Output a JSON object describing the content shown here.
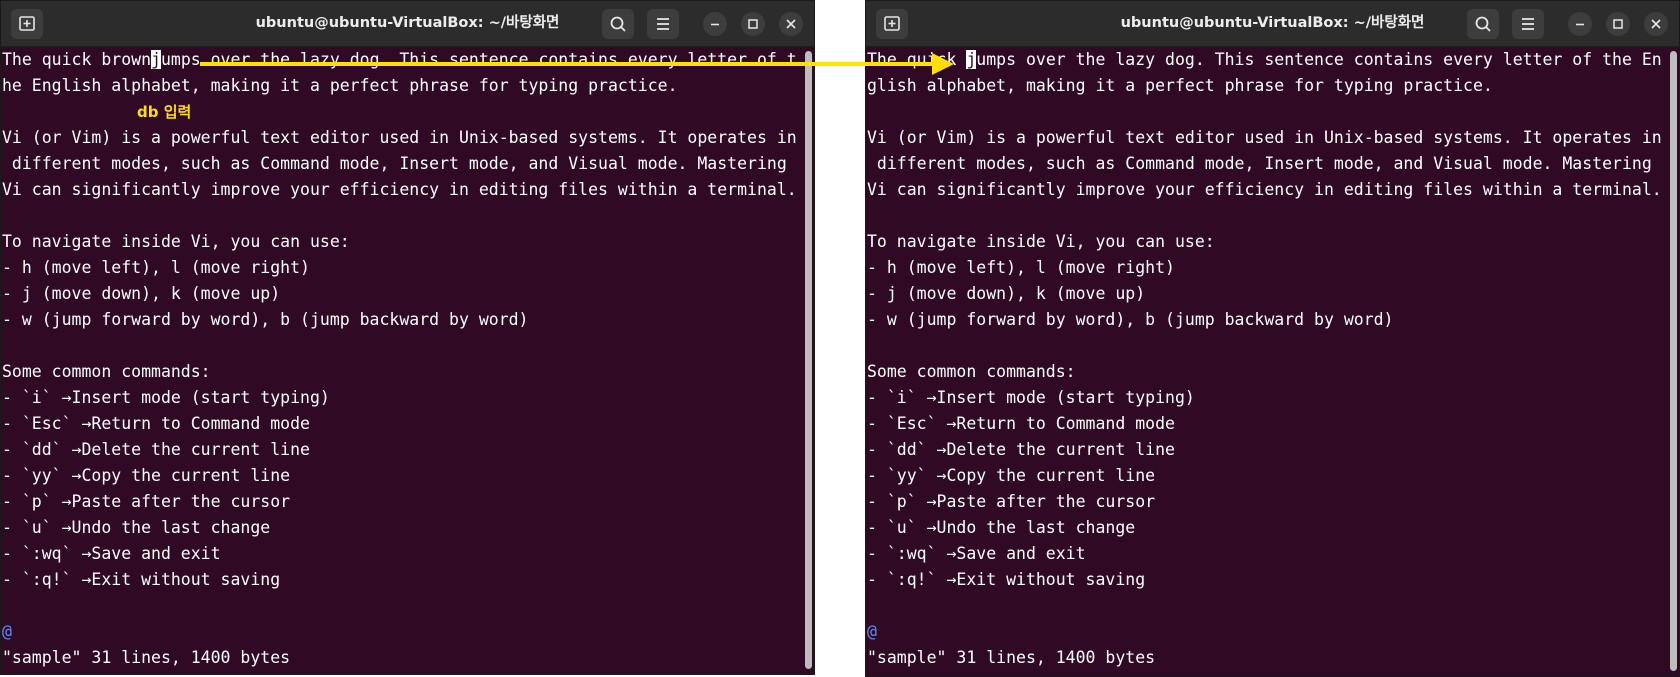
{
  "left_window": {
    "title": "ubuntu@ubuntu-VirtualBox: ~/바탕화면",
    "before_cursor": "The quick brown",
    "cursor_char": "j",
    "after_cursor": "umps over the lazy dog. This sentence contains every letter of t",
    "lines": [
      "he English alphabet, making it a perfect phrase for typing practice.",
      "",
      "Vi (or Vim) is a powerful text editor used in Unix-based systems. It operates in",
      " different modes, such as Command mode, Insert mode, and Visual mode. Mastering",
      "Vi can significantly improve your efficiency in editing files within a terminal.",
      "",
      "To navigate inside Vi, you can use:",
      "- h (move left), l (move right)",
      "- j (move down), k (move up)",
      "- w (jump forward by word), b (jump backward by word)",
      "",
      "Some common commands:",
      "- `i` →Insert mode (start typing)",
      "- `Esc` →Return to Command mode",
      "- `dd` →Delete the current line",
      "- `yy` →Copy the current line",
      "- `p` →Paste after the cursor",
      "- `u` →Undo the last change",
      "- `:wq` →Save and exit",
      "- `:q!` →Exit without saving",
      ""
    ],
    "tilde": "@",
    "status": "\"sample\" 31 lines, 1400 bytes"
  },
  "right_window": {
    "title": "ubuntu@ubuntu-VirtualBox: ~/바탕화면",
    "before_cursor": "The quick ",
    "cursor_char": "j",
    "after_cursor": "umps over the lazy dog. This sentence contains every letter of the En",
    "lines": [
      "glish alphabet, making it a perfect phrase for typing practice.",
      "",
      "Vi (or Vim) is a powerful text editor used in Unix-based systems. It operates in",
      " different modes, such as Command mode, Insert mode, and Visual mode. Mastering",
      "Vi can significantly improve your efficiency in editing files within a terminal.",
      "",
      "To navigate inside Vi, you can use:",
      "- h (move left), l (move right)",
      "- j (move down), k (move up)",
      "- w (jump forward by word), b (jump backward by word)",
      "",
      "Some common commands:",
      "- `i` →Insert mode (start typing)",
      "- `Esc` →Return to Command mode",
      "- `dd` →Delete the current line",
      "- `yy` →Copy the current line",
      "- `p` →Paste after the cursor",
      "- `u` →Undo the last change",
      "- `:wq` →Save and exit",
      "- `:q!` →Exit without saving",
      ""
    ],
    "tilde": "@",
    "status": "\"sample\" 31 lines, 1400 bytes"
  },
  "annotation": {
    "label": "db 입력",
    "color": "#ffe000"
  },
  "icons": {
    "new_tab": "new-tab-icon",
    "search": "search-icon",
    "menu": "hamburger-menu-icon",
    "minimize": "minimize-icon",
    "maximize": "maximize-icon",
    "close": "close-icon"
  },
  "colors": {
    "terminal_bg": "#300a24",
    "titlebar_bg": "#2c2c2c",
    "text": "#ffffff",
    "tilde": "#5c8cff",
    "annotation": "#ffe000"
  }
}
